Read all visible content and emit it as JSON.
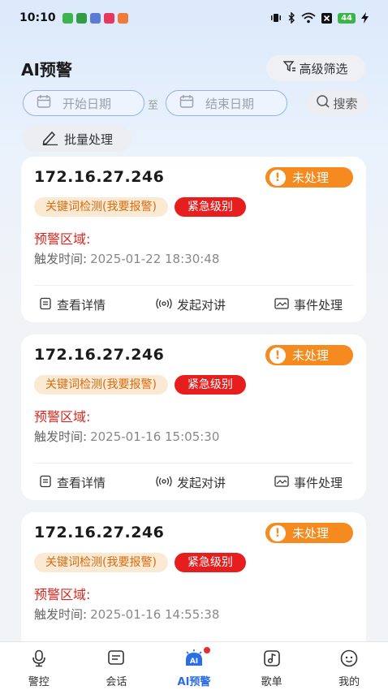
{
  "status_bar": {
    "time": "10:10",
    "battery": "44"
  },
  "header": {
    "title": "AI预警",
    "filter_label": "高级筛选"
  },
  "date_filter": {
    "start_placeholder": "开始日期",
    "separator": "至",
    "end_placeholder": "结束日期",
    "search_label": "搜索"
  },
  "batch_label": "批量处理",
  "cards": [
    {
      "ip": "172.16.27.246",
      "status": "未处理",
      "tag_keyword": "关键词检测(我要报警)",
      "tag_level": "紧急级别",
      "region_label": "预警区域:",
      "time_label": "触发时间:",
      "time_value": "2025-01-22 18:30:48",
      "action_detail": "查看详情",
      "action_talk": "发起对讲",
      "action_handle": "事件处理"
    },
    {
      "ip": "172.16.27.246",
      "status": "未处理",
      "tag_keyword": "关键词检测(我要报警)",
      "tag_level": "紧急级别",
      "region_label": "预警区域:",
      "time_label": "触发时间:",
      "time_value": "2025-01-16 15:05:30",
      "action_detail": "查看详情",
      "action_talk": "发起对讲",
      "action_handle": "事件处理"
    },
    {
      "ip": "172.16.27.246",
      "status": "未处理",
      "tag_keyword": "关键词检测(我要报警)",
      "tag_level": "紧急级别",
      "region_label": "预警区域:",
      "time_label": "触发时间:",
      "time_value": "2025-01-16 14:55:38"
    }
  ],
  "nav": {
    "items": [
      {
        "label": "警控",
        "icon": "mic-icon"
      },
      {
        "label": "会话",
        "icon": "chat-icon"
      },
      {
        "label": "AI预警",
        "icon": "ai-alert-icon"
      },
      {
        "label": "歌单",
        "icon": "music-icon"
      },
      {
        "label": "我的",
        "icon": "profile-icon"
      }
    ]
  },
  "colors": {
    "accent": "#2b6de8",
    "warning": "#f58a1f",
    "urgent": "#e61e1e",
    "region": "#d9261c"
  }
}
